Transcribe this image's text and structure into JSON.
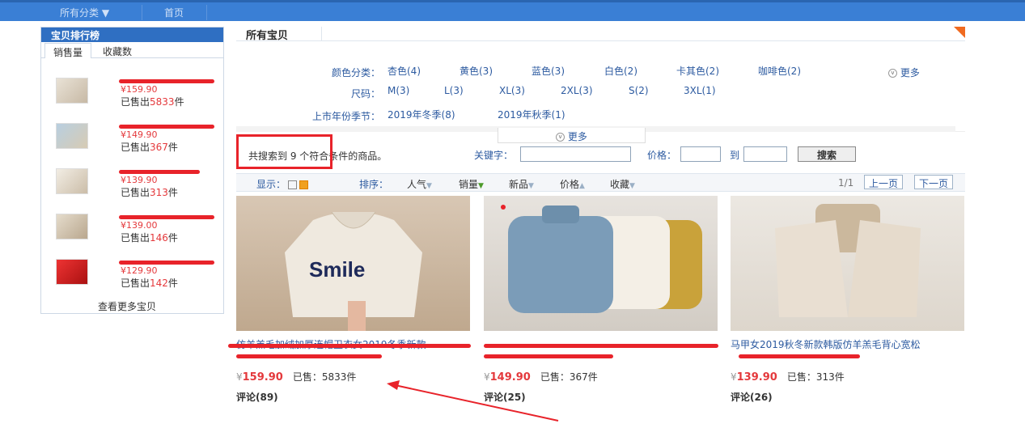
{
  "topnav": {
    "categories": "所有分类 ▼",
    "home": "首页"
  },
  "ranking": {
    "title": "宝贝排行榜",
    "tabs": [
      "销售量",
      "收藏数"
    ],
    "items": [
      {
        "price": "¥159.90",
        "sold_prefix": "已售出",
        "sold": "5833",
        "sold_suffix": "件"
      },
      {
        "price": "¥149.90",
        "sold_prefix": "已售出",
        "sold": "367",
        "sold_suffix": "件"
      },
      {
        "price": "¥139.90",
        "sold_prefix": "已售出",
        "sold": "313",
        "sold_suffix": "件"
      },
      {
        "price": "¥139.00",
        "sold_prefix": "已售出",
        "sold": "146",
        "sold_suffix": "件"
      },
      {
        "price": "¥129.90",
        "sold_prefix": "已售出",
        "sold": "142",
        "sold_suffix": "件"
      }
    ],
    "more": "查看更多宝贝"
  },
  "main": {
    "title": "所有宝贝",
    "filters": {
      "color_label": "颜色分类：",
      "colors": [
        "杏色(4)",
        "黄色(3)",
        "蓝色(3)",
        "白色(2)",
        "卡其色(2)",
        "咖啡色(2)"
      ],
      "more": "更多",
      "size_label": "尺码：",
      "sizes": [
        "M(3)",
        "L(3)",
        "XL(3)",
        "2XL(3)",
        "S(2)",
        "3XL(1)"
      ],
      "season_label": "上市年份季节：",
      "seasons": [
        "2019年冬季(8)",
        "2019年秋季(1)"
      ],
      "expand": "更多"
    },
    "search": {
      "result": "共搜索到 9 个符合条件的商品。",
      "keyword_label": "关键字：",
      "price_label": "价格：",
      "to": "到",
      "button": "搜索"
    },
    "sort": {
      "display": "显示：",
      "sort_label": "排序：",
      "options": [
        "人气",
        "销量",
        "新品",
        "价格",
        "收藏"
      ],
      "page": "1/1",
      "prev": "上一页",
      "next": "下一页"
    },
    "products": [
      {
        "name_visible": "仿羊羔毛加绒加厚连帽卫衣女2019冬季新款",
        "currency": "¥",
        "price": "159.90",
        "sold_label": "已售：",
        "sold": "5833件",
        "comment": "评论(89)"
      },
      {
        "name_visible": "",
        "currency": "¥",
        "price": "149.90",
        "sold_label": "已售：",
        "sold": "367件",
        "comment": "评论(25)"
      },
      {
        "name_visible": "马甲女2019秋冬新款韩版仿羊羔毛背心宽松",
        "currency": "¥",
        "price": "139.90",
        "sold_label": "已售：",
        "sold": "313件",
        "comment": "评论(26)"
      }
    ]
  },
  "colors": {
    "accent_blue": "#3a7fd5",
    "price_red": "#e4393c",
    "annotation_red": "#e8232a"
  }
}
